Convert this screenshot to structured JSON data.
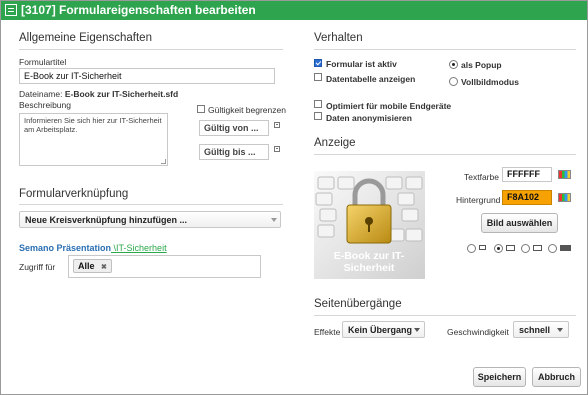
{
  "window": {
    "title": "[3107] Formulareigenschaften bearbeiten"
  },
  "general": {
    "section_title": "Allgemeine Eigenschaften",
    "form_title_label": "Formulartitel",
    "form_title_value": "E-Book zur IT-Sicherheit",
    "filename_label": "Dateiname:",
    "filename_value": "E-Book zur IT-Sicherheit.sfd",
    "description_label": "Beschreibung",
    "description_value": "Informieren Sie sich hier zur IT-Sicherheit am Arbeitsplatz.",
    "validity_label": "Gültigkeit begrenzen",
    "valid_from_placeholder": "Gültig von ...",
    "valid_to_placeholder": "Gültig bis ..."
  },
  "linking": {
    "section_title": "Formularverknüpfung",
    "select_value": "Neue Kreisverknüpfung hinzufügen ...",
    "path_root": "Semano Präsentation",
    "path_sep": " \\",
    "path_leaf": "IT-Sicherheit",
    "access_label": "Zugriff für",
    "access_tag": "Alle",
    "tag_remove": "✖"
  },
  "behaviour": {
    "section_title": "Verhalten",
    "form_active": "Formular ist aktiv",
    "show_datatable": "Datentabelle anzeigen",
    "as_popup": "als Popup",
    "fullscreen": "Vollbildmodus",
    "mobile_optimized": "Optimiert für mobile Endgeräte",
    "anonymize": "Daten anonymisieren"
  },
  "display": {
    "section_title": "Anzeige",
    "text_color_label": "Textfarbe",
    "text_color_value": "FFFFFF",
    "background_label": "Hintergrund",
    "background_value": "F8A102",
    "choose_image_button": "Bild auswählen",
    "image_caption": "E-Book zur IT-Sicherheit",
    "colors": {
      "background": "#F8A102",
      "text": "#FFFFFF"
    }
  },
  "transitions": {
    "section_title": "Seitenübergänge",
    "effects_label": "Effekte",
    "effects_value": "Kein Übergang",
    "speed_label": "Geschwindigkeit",
    "speed_value": "schnell"
  },
  "footer": {
    "save_button": "Speichern",
    "cancel_button": "Abbruch"
  },
  "accent_color": "#2FA44F"
}
